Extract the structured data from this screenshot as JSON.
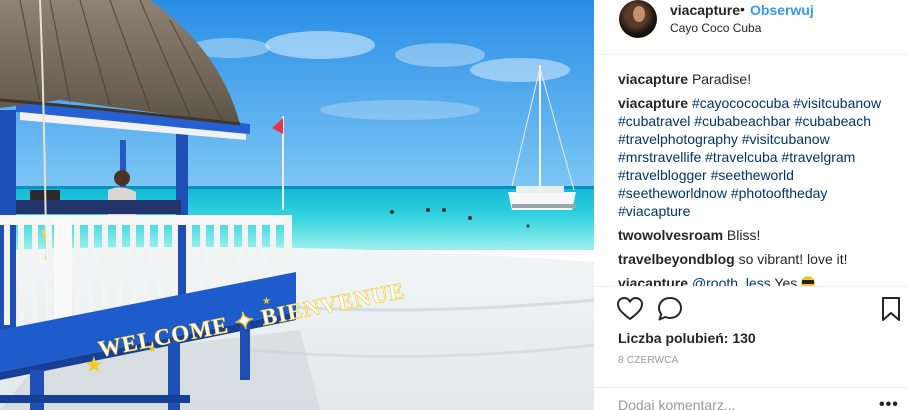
{
  "post": {
    "username": "viacapture",
    "header_dot": "•",
    "follow_label": "Obserwuj",
    "location": "Cayo Coco Cuba",
    "photo_sign": "WELCOME ✦ BIENVENUE",
    "comments": [
      {
        "user": "viacapture",
        "text": "Paradise!"
      },
      {
        "user": "viacapture",
        "tags": [
          "#cayocococuba",
          "#visitcubanow",
          "#cubatravel",
          "#cubabeachbar",
          "#cubabeach",
          "#travelphotography",
          "#visitcubanow",
          "#mrstravellife",
          "#travelcuba",
          "#travelgram",
          "#travelblogger",
          "#seetheworld",
          "#seetheworldnow",
          "#photooftheday",
          "#viacapture"
        ]
      },
      {
        "user": "twowolvesroam",
        "text": "Bliss!"
      },
      {
        "user": "travelbeyondblog",
        "text": "so vibrant! love it!"
      },
      {
        "user": "viacapture",
        "mention": "@rooth_less",
        "text": "Yes"
      }
    ],
    "likes_label": "Liczba polubień: 130",
    "date": "8 CZERWCA",
    "comment_placeholder": "Dodaj komentarz...",
    "more_label": "•••"
  },
  "icons": {
    "like": "heart-outline-icon",
    "comment": "speech-bubble-icon",
    "save": "bookmark-icon"
  }
}
